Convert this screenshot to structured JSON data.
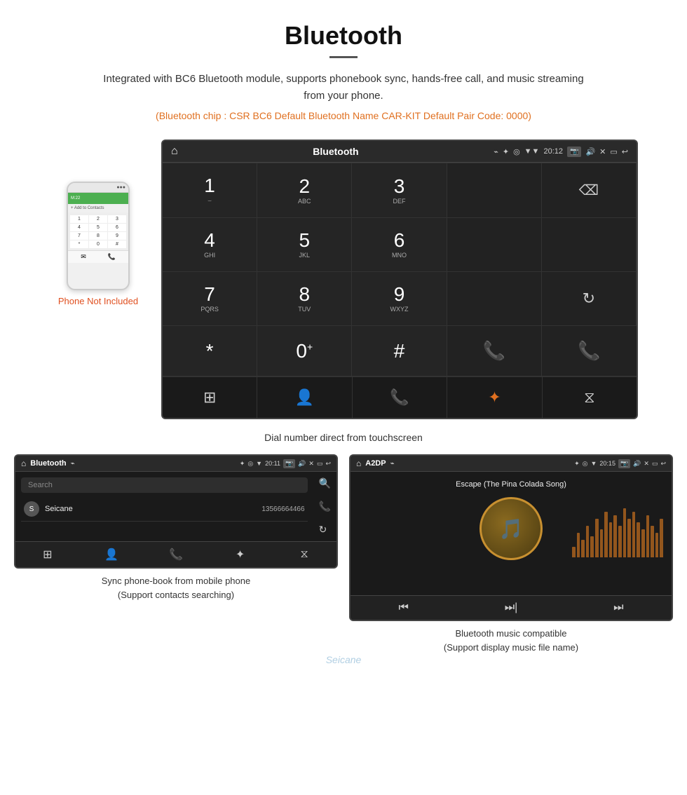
{
  "header": {
    "title": "Bluetooth",
    "description": "Integrated with BC6 Bluetooth module, supports phonebook sync, hands-free call, and music streaming from your phone.",
    "specs": "(Bluetooth chip : CSR BC6    Default Bluetooth Name CAR-KIT    Default Pair Code: 0000)"
  },
  "phone_mockup": {
    "not_included_label": "Phone Not Included",
    "top_dots": "●●●",
    "green_bar_text": "M:22",
    "contact_text": "+ Add to Contacts",
    "keys": [
      "1",
      "2",
      "3",
      "4",
      "5",
      "6",
      "7",
      "8",
      "9",
      "*",
      "0",
      "#"
    ],
    "bottom_icons": [
      "✉",
      "📞"
    ]
  },
  "main_screen": {
    "statusbar": {
      "home_icon": "⌂",
      "title": "Bluetooth",
      "usb_icon": "⌁",
      "bt_icon": "✦",
      "location_icon": "◎",
      "signal_icon": "▼",
      "time": "20:12",
      "camera_icon": "⬛",
      "volume_icon": "◁",
      "x_icon": "✕",
      "screen_icon": "▭",
      "back_icon": "↩"
    },
    "dialpad": {
      "keys": [
        {
          "num": "1",
          "sub": "⌣"
        },
        {
          "num": "2",
          "sub": "ABC"
        },
        {
          "num": "3",
          "sub": "DEF"
        },
        {
          "num": "",
          "sub": ""
        },
        {
          "num": "⌫",
          "sub": "",
          "type": "backspace"
        },
        {
          "num": "4",
          "sub": "GHI"
        },
        {
          "num": "5",
          "sub": "JKL"
        },
        {
          "num": "6",
          "sub": "MNO"
        },
        {
          "num": "",
          "sub": ""
        },
        {
          "num": "",
          "sub": ""
        },
        {
          "num": "7",
          "sub": "PQRS"
        },
        {
          "num": "8",
          "sub": "TUV"
        },
        {
          "num": "9",
          "sub": "WXYZ"
        },
        {
          "num": "",
          "sub": ""
        },
        {
          "num": "↻",
          "sub": "",
          "type": "refresh"
        },
        {
          "num": "*",
          "sub": ""
        },
        {
          "num": "0+",
          "sub": ""
        },
        {
          "num": "#",
          "sub": ""
        },
        {
          "num": "📞",
          "sub": "",
          "type": "call-green"
        },
        {
          "num": "📞",
          "sub": "",
          "type": "call-red"
        }
      ],
      "bottom_icons": [
        "⊞",
        "👤",
        "📞",
        "✦",
        "⧖"
      ]
    }
  },
  "caption_main": "Dial number direct from touchscreen",
  "phonebook_screen": {
    "statusbar": {
      "title": "Bluetooth",
      "time": "20:11"
    },
    "search_placeholder": "Search",
    "contacts": [
      {
        "letter": "S",
        "name": "Seicane",
        "number": "13566664466"
      }
    ],
    "bottom_icons": [
      "⊞",
      "👤",
      "📞",
      "✦",
      "⧖"
    ]
  },
  "a2dp_screen": {
    "statusbar": {
      "title": "A2DP",
      "time": "20:15"
    },
    "song_title": "Escape (The Pina Colada Song)",
    "eq_bars": [
      3,
      7,
      5,
      9,
      6,
      11,
      8,
      13,
      10,
      12,
      9,
      14,
      11,
      13,
      10,
      8,
      12,
      9,
      7,
      11
    ],
    "controls": [
      "⏮",
      "⏭|",
      "⏭"
    ]
  },
  "caption_phonebook": "Sync phone-book from mobile phone\n(Support contacts searching)",
  "caption_a2dp": "Bluetooth music compatible\n(Support display music file name)",
  "watermark": "Seicane"
}
